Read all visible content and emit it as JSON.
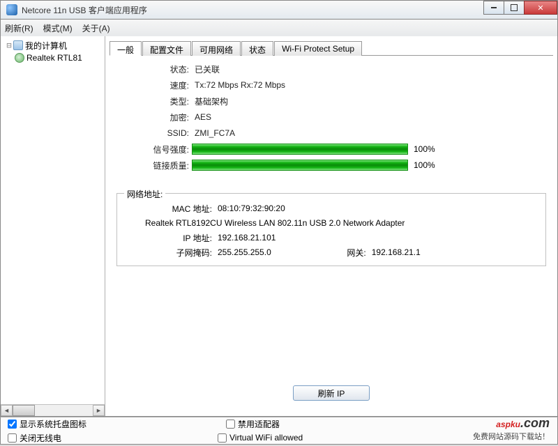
{
  "window": {
    "title": "Netcore 11n USB 客户端应用程序"
  },
  "menu": {
    "refresh": "刷新(R)",
    "mode": "模式(M)",
    "about": "关于(A)"
  },
  "tree": {
    "root": "我的计算机",
    "adapter": "Realtek RTL81"
  },
  "tabs": {
    "general": "一般",
    "profile": "配置文件",
    "available": "可用网络",
    "status": "状态",
    "wps": "Wi-Fi Protect Setup"
  },
  "fields": {
    "status_label": "状态:",
    "status_value": "已关联",
    "speed_label": "速度:",
    "speed_value": "Tx:72 Mbps Rx:72 Mbps",
    "type_label": "类型:",
    "type_value": "基础架构",
    "encrypt_label": "加密:",
    "encrypt_value": "AES",
    "ssid_label": "SSID:",
    "ssid_value": "ZMI_FC7A",
    "signal_label": "信号强度:",
    "signal_pct": "100%",
    "link_label": "链接质量:",
    "link_pct": "100%"
  },
  "network": {
    "group_title": "网络地址:",
    "mac_label": "MAC 地址:",
    "mac": "08:10:79:32:90:20",
    "adapter_name": "Realtek RTL8192CU Wireless LAN 802.11n USB 2.0 Network Adapter",
    "ip_label": "IP 地址:",
    "ip": "192.168.21.101",
    "mask_label": "子网掩码:",
    "mask": "255.255.255.0",
    "gateway_label": "网关:",
    "gateway": "192.168.21.1"
  },
  "buttons": {
    "refresh_ip": "刷新 IP"
  },
  "checkboxes": {
    "tray": "显示系统托盘图标",
    "disable_adapter": "禁用适配器",
    "radio_off": "关闭无线电",
    "virtual_wifi": "Virtual WiFi allowed"
  },
  "watermark": {
    "brand": "aspku",
    "dotcom": ".com",
    "slogan": "免费网站源码下载站！"
  },
  "chart_data": {
    "type": "bar",
    "series": [
      {
        "name": "信号强度",
        "value": 100,
        "max": 100
      },
      {
        "name": "链接质量",
        "value": 100,
        "max": 100
      }
    ]
  }
}
